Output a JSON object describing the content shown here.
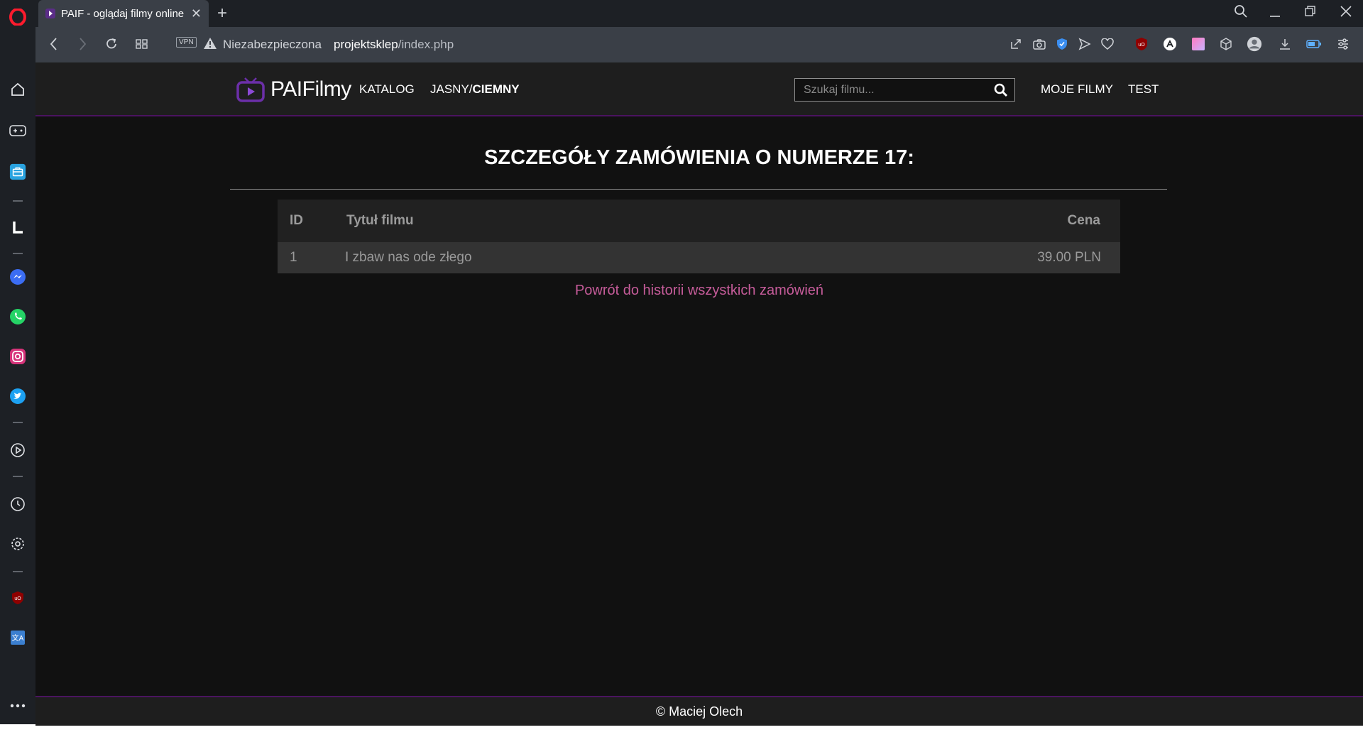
{
  "browser": {
    "tab_title": "PAIF - oglądaj filmy online",
    "new_tab": "+",
    "vpn_label": "VPN",
    "security_label": "Niezabezpieczona",
    "url_host": "projektsklep",
    "url_path": "/index.php"
  },
  "site": {
    "logo_text": "PAIFilmy",
    "nav": {
      "catalog": "KATALOG",
      "theme_light": "JASNY/",
      "theme_dark": "CIEMNY",
      "my_films": "MOJE FILMY",
      "user": "TEST"
    },
    "search_placeholder": "Szukaj filmu..."
  },
  "order": {
    "heading": "SZCZEGÓŁY ZAMÓWIENIA O NUMERZE 17:",
    "columns": {
      "id": "ID",
      "title": "Tytuł filmu",
      "price": "Cena"
    },
    "rows": [
      {
        "id": "1",
        "title": "I zbaw nas ode złego",
        "price": "39.00 PLN"
      }
    ],
    "back_link": "Powrót do historii wszystkich zamówień"
  },
  "footer": {
    "text": "© Maciej Olech"
  },
  "colors": {
    "accent": "#c65c9a",
    "brand_purple": "#5b2d88",
    "border_purple": "#4b1460"
  }
}
